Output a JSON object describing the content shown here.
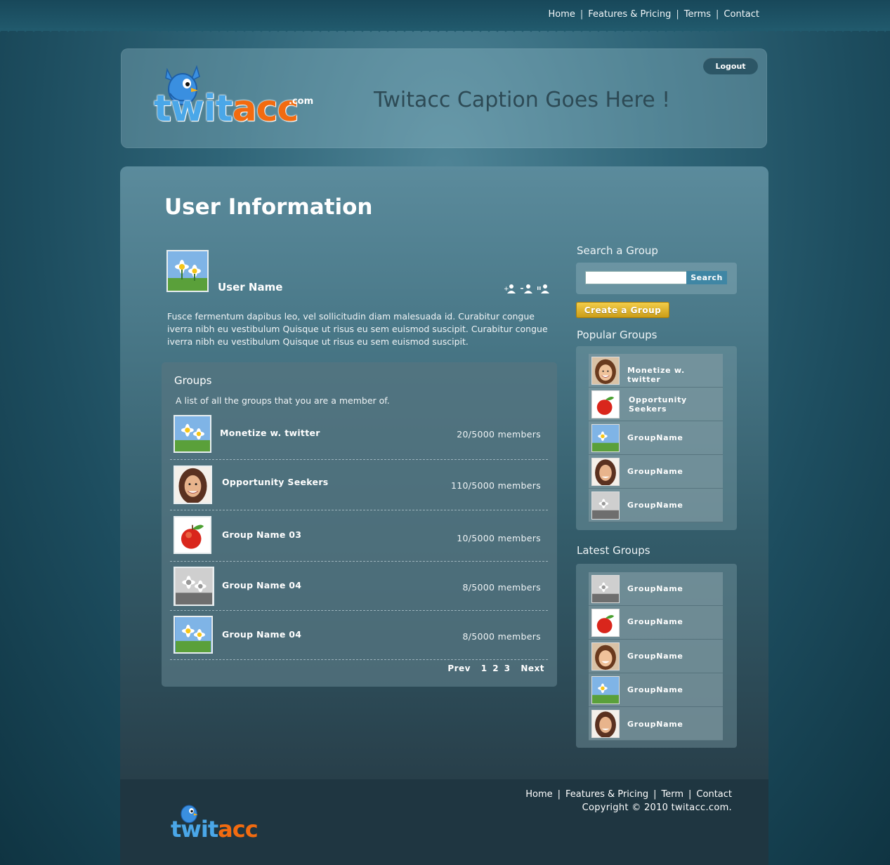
{
  "top_nav": {
    "items": [
      {
        "label": "Home"
      },
      {
        "label": "Features & Pricing"
      },
      {
        "label": "Terms"
      },
      {
        "label": "Contact"
      }
    ],
    "separator": "|"
  },
  "header": {
    "logo": {
      "blue_part": "twit",
      "orange_part": "acc",
      "suffix": ".com"
    },
    "caption": "Twitacc Caption Goes Here !",
    "logout_label": "Logout"
  },
  "user": {
    "page_title": "User Information",
    "name": "User Name",
    "bio": "Fusce fermentum dapibus leo, vel sollicitudin diam malesuada id. Curabitur congue iverra nibh eu vestibulum Quisque ut risus eu sem euismod suscipit. Curabitur congue iverra nibh eu vestibulum Quisque ut risus eu sem euismod suscipit.",
    "action_icons": [
      "add-user-icon",
      "remove-user-icon",
      "block-user-icon"
    ]
  },
  "groups": {
    "title": "Groups",
    "subtitle": "A list of all the groups that you are a member of.",
    "rows": [
      {
        "name": "Monetize w. twitter",
        "members": "20/5000 members",
        "thumb": "daisy"
      },
      {
        "name": "Opportunity Seekers",
        "members": "110/5000 members",
        "thumb": "woman"
      },
      {
        "name": "Group Name 03",
        "members": "10/5000 members",
        "thumb": "apple"
      },
      {
        "name": "Group Name 04",
        "members": "8/5000 members",
        "thumb": "daisy-gray"
      },
      {
        "name": "Group Name 04",
        "members": "8/5000 members",
        "thumb": "daisy"
      }
    ],
    "pager": {
      "prev": "Prev",
      "pages": [
        "1",
        "2",
        "3"
      ],
      "next": "Next"
    }
  },
  "sidebar": {
    "search_title": "Search a Group",
    "search_placeholder": "",
    "search_button": "Search",
    "create_button": "Create a Group",
    "popular_title": "Popular Groups",
    "popular": [
      {
        "name": "Monetize w. twitter",
        "thumb": "girl"
      },
      {
        "name": "Opportunity Seekers",
        "thumb": "apple"
      },
      {
        "name": "GroupName",
        "thumb": "daisy"
      },
      {
        "name": "GroupName",
        "thumb": "woman"
      },
      {
        "name": "GroupName",
        "thumb": "daisy-gray"
      }
    ],
    "latest_title": "Latest Groups",
    "latest": [
      {
        "name": "GroupName",
        "thumb": "daisy-gray"
      },
      {
        "name": "GroupName",
        "thumb": "apple"
      },
      {
        "name": "GroupName",
        "thumb": "girl"
      },
      {
        "name": "GroupName",
        "thumb": "daisy"
      },
      {
        "name": "GroupName",
        "thumb": "woman"
      }
    ]
  },
  "footer": {
    "logo": {
      "blue_part": "twit",
      "orange_part": "acc"
    },
    "nav": [
      {
        "label": "Home"
      },
      {
        "label": "Features & Pricing"
      },
      {
        "label": "Term"
      },
      {
        "label": "Contact"
      }
    ],
    "copyright": "Copyright © 2010 twitacc.com."
  },
  "colors": {
    "brand_blue": "#4aa7e8",
    "brand_orange": "#f26b10",
    "create_button": "#e0b52c",
    "search_button": "#3f86a4"
  }
}
